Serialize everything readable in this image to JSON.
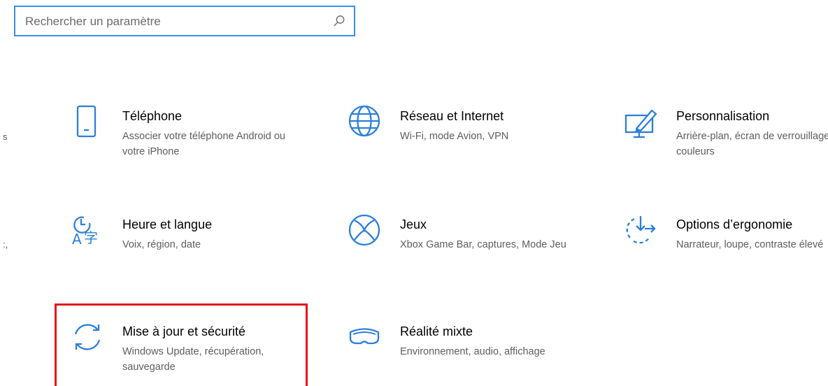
{
  "search": {
    "placeholder": "Rechercher un paramètre",
    "icon": "search-icon"
  },
  "left_clipped": [
    "s",
    ":,"
  ],
  "accent_color": "#3b8fe6",
  "highlight_color": "#e3141b",
  "tiles": [
    {
      "title": "Téléphone",
      "desc": "Associer votre téléphone Android ou votre iPhone",
      "icon": "phone-icon"
    },
    {
      "title": "Réseau et Internet",
      "desc": "Wi-Fi, mode Avion, VPN",
      "icon": "globe-icon"
    },
    {
      "title": "Personnalisation",
      "desc": "Arrière-plan, écran de verrouillage, couleurs",
      "icon": "personalization-icon"
    },
    {
      "title": "Heure et langue",
      "desc": "Voix, région, date",
      "icon": "time-language-icon"
    },
    {
      "title": "Jeux",
      "desc": "Xbox Game Bar, captures, Mode Jeu",
      "icon": "xbox-icon"
    },
    {
      "title": "Options d’ergonomie",
      "desc": "Narrateur, loupe, contraste élevé",
      "icon": "ease-of-access-icon"
    },
    {
      "title": "Mise à jour et sécurité",
      "desc": "Windows Update, récupération, sauvegarde",
      "icon": "update-sync-icon"
    },
    {
      "title": "Réalité mixte",
      "desc": "Environnement, audio, affichage",
      "icon": "mixed-reality-icon"
    }
  ]
}
